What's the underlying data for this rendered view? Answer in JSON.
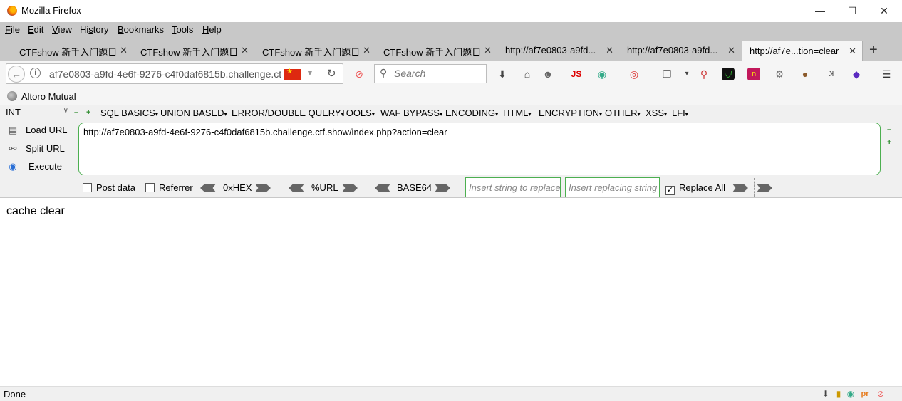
{
  "window": {
    "title": "Mozilla Firefox",
    "minimize": "—",
    "maximize": "☐",
    "close": "✕"
  },
  "menubar": [
    {
      "label": "File",
      "key": "F"
    },
    {
      "label": "Edit",
      "key": "E"
    },
    {
      "label": "View",
      "key": "V"
    },
    {
      "label": "History",
      "key": "s"
    },
    {
      "label": "Bookmarks",
      "key": "B"
    },
    {
      "label": "Tools",
      "key": "T"
    },
    {
      "label": "Help",
      "key": "H"
    }
  ],
  "tabs": [
    {
      "label": "CTFshow 新手入门题目"
    },
    {
      "label": "CTFshow 新手入门题目"
    },
    {
      "label": "CTFshow 新手入门题目"
    },
    {
      "label": "CTFshow 新手入门题目"
    },
    {
      "label": "http://af7e0803-a9fd..."
    },
    {
      "label": "http://af7e0803-a9fd..."
    },
    {
      "label": "http://af7e...tion=clear",
      "active": true
    }
  ],
  "tab_close": "✕",
  "new_tab": "+",
  "navbar": {
    "url": "af7e0803-a9fd-4e6f-9276-c4f0daf6815b.challenge.ctf.show/index.php?action=clear",
    "search_placeholder": "Search"
  },
  "bookmarks": {
    "item": "Altoro Mutual"
  },
  "hackbar": {
    "type_select": "INT",
    "menus": [
      "SQL BASICS",
      "UNION BASED",
      "ERROR/DOUBLE QUERY",
      "TOOLS",
      "WAF BYPASS",
      "ENCODING",
      "HTML",
      "ENCRYPTION",
      "OTHER",
      "XSS",
      "LFI"
    ],
    "load_url": "Load URL",
    "split_url": "Split URL",
    "execute": "Execute",
    "url_value": "http://af7e0803-a9fd-4e6f-9276-c4f0daf6815b.challenge.ctf.show/index.php?action=clear",
    "post_data": "Post data",
    "referrer": "Referrer",
    "hex": "0xHEX",
    "url_enc": "%URL",
    "base64": "BASE64",
    "replace_placeholder": "Insert string to replace",
    "replacing_placeholder": "Insert replacing string",
    "replace_all": "Replace All",
    "replace_all_checked": true
  },
  "page": {
    "content": "cache clear"
  },
  "statusbar": {
    "status": "Done"
  }
}
